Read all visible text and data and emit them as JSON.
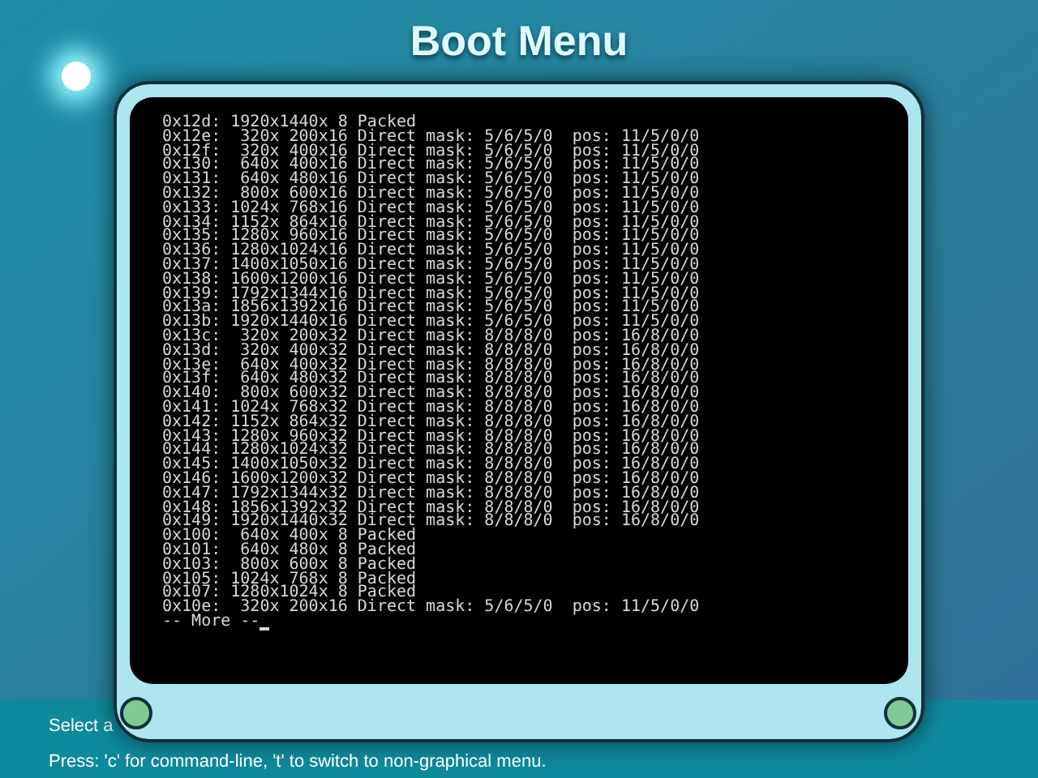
{
  "title": "Boot Menu",
  "console": {
    "lines": [
      "0x12d: 1920x1440x 8 Packed",
      "0x12e:  320x 200x16 Direct mask: 5/6/5/0  pos: 11/5/0/0",
      "0x12f:  320x 400x16 Direct mask: 5/6/5/0  pos: 11/5/0/0",
      "0x130:  640x 400x16 Direct mask: 5/6/5/0  pos: 11/5/0/0",
      "0x131:  640x 480x16 Direct mask: 5/6/5/0  pos: 11/5/0/0",
      "0x132:  800x 600x16 Direct mask: 5/6/5/0  pos: 11/5/0/0",
      "0x133: 1024x 768x16 Direct mask: 5/6/5/0  pos: 11/5/0/0",
      "0x134: 1152x 864x16 Direct mask: 5/6/5/0  pos: 11/5/0/0",
      "0x135: 1280x 960x16 Direct mask: 5/6/5/0  pos: 11/5/0/0",
      "0x136: 1280x1024x16 Direct mask: 5/6/5/0  pos: 11/5/0/0",
      "0x137: 1400x1050x16 Direct mask: 5/6/5/0  pos: 11/5/0/0",
      "0x138: 1600x1200x16 Direct mask: 5/6/5/0  pos: 11/5/0/0",
      "0x139: 1792x1344x16 Direct mask: 5/6/5/0  pos: 11/5/0/0",
      "0x13a: 1856x1392x16 Direct mask: 5/6/5/0  pos: 11/5/0/0",
      "0x13b: 1920x1440x16 Direct mask: 5/6/5/0  pos: 11/5/0/0",
      "0x13c:  320x 200x32 Direct mask: 8/8/8/0  pos: 16/8/0/0",
      "0x13d:  320x 400x32 Direct mask: 8/8/8/0  pos: 16/8/0/0",
      "0x13e:  640x 400x32 Direct mask: 8/8/8/0  pos: 16/8/0/0",
      "0x13f:  640x 480x32 Direct mask: 8/8/8/0  pos: 16/8/0/0",
      "0x140:  800x 600x32 Direct mask: 8/8/8/0  pos: 16/8/0/0",
      "0x141: 1024x 768x32 Direct mask: 8/8/8/0  pos: 16/8/0/0",
      "0x142: 1152x 864x32 Direct mask: 8/8/8/0  pos: 16/8/0/0",
      "0x143: 1280x 960x32 Direct mask: 8/8/8/0  pos: 16/8/0/0",
      "0x144: 1280x1024x32 Direct mask: 8/8/8/0  pos: 16/8/0/0",
      "0x145: 1400x1050x32 Direct mask: 8/8/8/0  pos: 16/8/0/0",
      "0x146: 1600x1200x32 Direct mask: 8/8/8/0  pos: 16/8/0/0",
      "0x147: 1792x1344x32 Direct mask: 8/8/8/0  pos: 16/8/0/0",
      "0x148: 1856x1392x32 Direct mask: 8/8/8/0  pos: 16/8/0/0",
      "0x149: 1920x1440x32 Direct mask: 8/8/8/0  pos: 16/8/0/0",
      "0x100:  640x 400x 8 Packed",
      "0x101:  640x 480x 8 Packed",
      "0x103:  800x 600x 8 Packed",
      "0x105: 1024x 768x 8 Packed",
      "0x107: 1280x1024x 8 Packed",
      "0x10e:  320x 200x16 Direct mask: 5/6/5/0  pos: 11/5/0/0"
    ],
    "prompt": "-- More --"
  },
  "help_lines": [
    "Select a",
    "Press: 'c' for command-line, 't' to switch to non-graphical menu."
  ]
}
